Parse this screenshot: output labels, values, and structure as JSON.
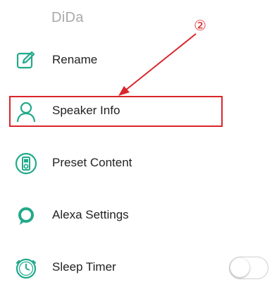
{
  "header": {
    "title": "DiDa"
  },
  "menu": {
    "items": [
      {
        "label": "Rename",
        "icon": "edit-icon"
      },
      {
        "label": "Speaker Info",
        "icon": "person-icon"
      },
      {
        "label": "Preset Content",
        "icon": "speaker-device-icon"
      },
      {
        "label": "Alexa Settings",
        "icon": "alexa-icon"
      },
      {
        "label": "Sleep Timer",
        "icon": "clock-icon"
      }
    ]
  },
  "sleep_timer_toggle": {
    "state": "off"
  },
  "annotation": {
    "number": "②",
    "highlighted_item": "Speaker Info"
  },
  "colors": {
    "accent": "#22a98a",
    "annotation": "#d9262b",
    "title": "#a9a9a9"
  }
}
